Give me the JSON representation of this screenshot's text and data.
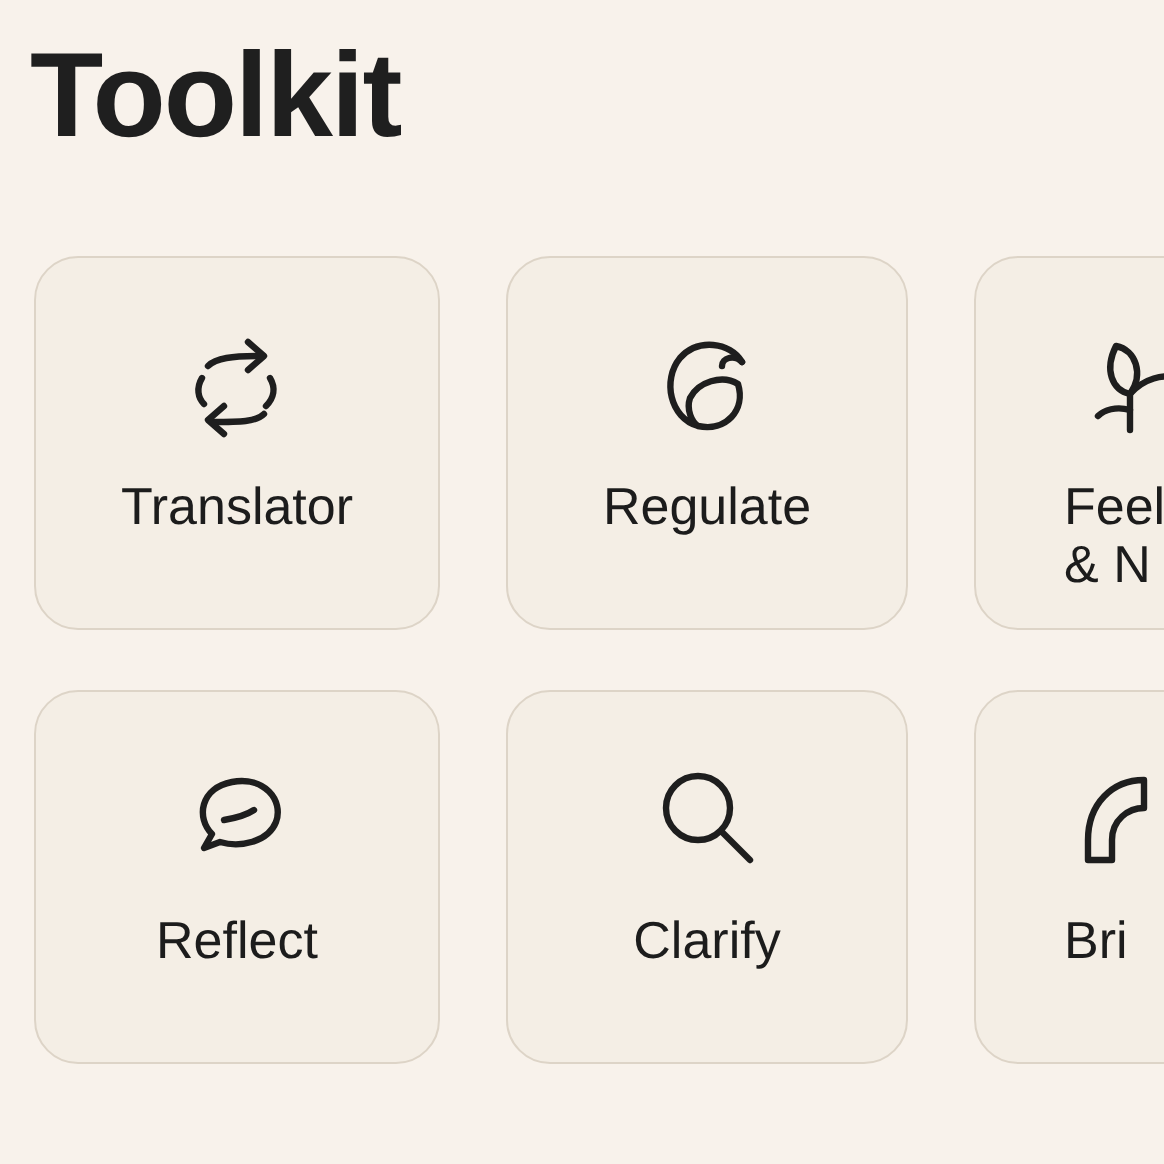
{
  "title": "Toolkit",
  "tools": [
    {
      "lines": [
        "Translator"
      ]
    },
    {
      "lines": [
        "Regulate"
      ]
    },
    {
      "lines": [
        "Feel",
        "& N"
      ]
    },
    {
      "lines": [
        "Reflect"
      ]
    },
    {
      "lines": [
        "Clarify"
      ]
    },
    {
      "lines": [
        "Bri"
      ]
    }
  ]
}
